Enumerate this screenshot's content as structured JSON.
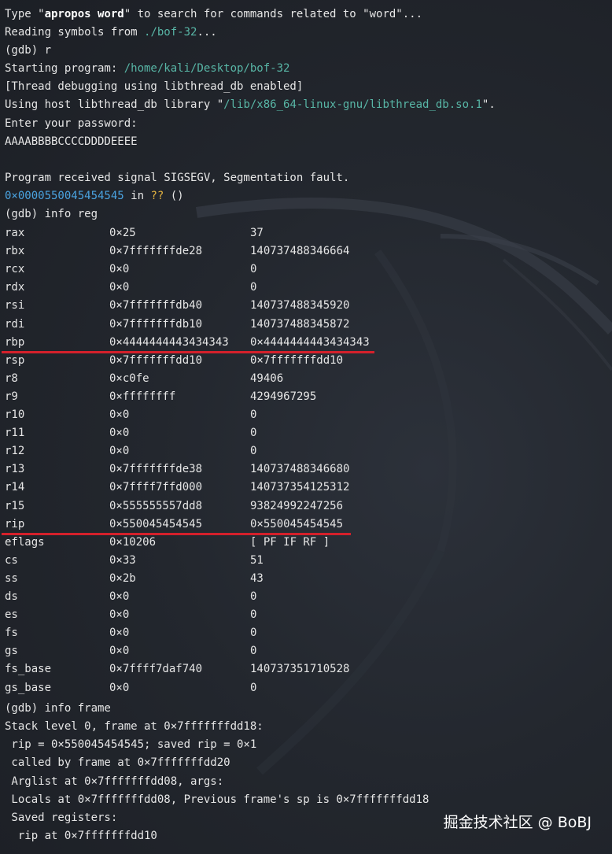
{
  "header": {
    "l1_pre": "Type \"",
    "l1_bold": "apropos word",
    "l1_post": "\" to search for commands related to \"word\"...",
    "l2_pre": "Reading symbols from ",
    "l2_path": "./bof-32",
    "l2_post": "...",
    "l3": "(gdb) r",
    "l4_pre": "Starting program: ",
    "l4_path": "/home/kali/Desktop/bof-32",
    "l5": "[Thread debugging using libthread_db enabled]",
    "l6_pre": "Using host libthread_db library \"",
    "l6_path": "/lib/x86_64-linux-gnu/libthread_db.so.1",
    "l6_post": "\".",
    "l7": "Enter your password:",
    "l8": "AAAABBBBCCCCDDDDEEEE",
    "l9": "Program received signal SIGSEGV, Segmentation fault.",
    "l10_addr": "0×0000550045454545",
    "l10_mid": " in ",
    "l10_q": "??",
    "l10_post": " ()",
    "l11": "(gdb) info reg"
  },
  "registers": [
    {
      "name": "rax",
      "hex": "0×25",
      "natural": "37"
    },
    {
      "name": "rbx",
      "hex": "0×7fffffffde28",
      "natural": "140737488346664"
    },
    {
      "name": "rcx",
      "hex": "0×0",
      "natural": "0"
    },
    {
      "name": "rdx",
      "hex": "0×0",
      "natural": "0"
    },
    {
      "name": "rsi",
      "hex": "0×7fffffffdb40",
      "natural": "140737488345920"
    },
    {
      "name": "rdi",
      "hex": "0×7fffffffdb10",
      "natural": "140737488345872"
    },
    {
      "name": "rbp",
      "hex": "0×4444444443434343",
      "natural": "0×4444444443434343"
    },
    {
      "name": "rsp",
      "hex": "0×7fffffffdd10",
      "natural": "0×7fffffffdd10"
    },
    {
      "name": "r8",
      "hex": "0×c0fe",
      "natural": "49406"
    },
    {
      "name": "r9",
      "hex": "0×ffffffff",
      "natural": "4294967295"
    },
    {
      "name": "r10",
      "hex": "0×0",
      "natural": "0"
    },
    {
      "name": "r11",
      "hex": "0×0",
      "natural": "0"
    },
    {
      "name": "r12",
      "hex": "0×0",
      "natural": "0"
    },
    {
      "name": "r13",
      "hex": "0×7fffffffde38",
      "natural": "140737488346680"
    },
    {
      "name": "r14",
      "hex": "0×7ffff7ffd000",
      "natural": "140737354125312"
    },
    {
      "name": "r15",
      "hex": "0×555555557dd8",
      "natural": "93824992247256"
    },
    {
      "name": "rip",
      "hex": "0×550045454545",
      "natural": "0×550045454545"
    },
    {
      "name": "eflags",
      "hex": "0×10206",
      "natural": "[ PF IF RF ]"
    },
    {
      "name": "cs",
      "hex": "0×33",
      "natural": "51"
    },
    {
      "name": "ss",
      "hex": "0×2b",
      "natural": "43"
    },
    {
      "name": "ds",
      "hex": "0×0",
      "natural": "0"
    },
    {
      "name": "es",
      "hex": "0×0",
      "natural": "0"
    },
    {
      "name": "fs",
      "hex": "0×0",
      "natural": "0"
    },
    {
      "name": "gs",
      "hex": "0×0",
      "natural": "0"
    },
    {
      "name": "fs_base",
      "hex": "0×7ffff7daf740",
      "natural": "140737351710528"
    },
    {
      "name": "gs_base",
      "hex": "0×0",
      "natural": "0"
    }
  ],
  "frame": {
    "cmd": "(gdb) info frame",
    "f1": "Stack level 0, frame at 0×7fffffffdd18:",
    "f2": " rip = 0×550045454545; saved rip = 0×1",
    "f3": " called by frame at 0×7fffffffdd20",
    "f4": " Arglist at 0×7fffffffdd08, args:",
    "f5": " Locals at 0×7fffffffdd08, Previous frame's sp is 0×7fffffffdd18",
    "f6": " Saved registers:",
    "f7": "  rip at 0×7fffffffdd10"
  },
  "watermark": "掘金技术社区 @ BoBJ",
  "highlighted_registers": [
    "rbp",
    "rip"
  ],
  "colors": {
    "background": "#1e2128",
    "text": "#e6e6e6",
    "path": "#58b6a6",
    "address": "#4aa3e0",
    "unknown_symbol": "#e3b341",
    "highlight_underline": "#d4202b"
  }
}
